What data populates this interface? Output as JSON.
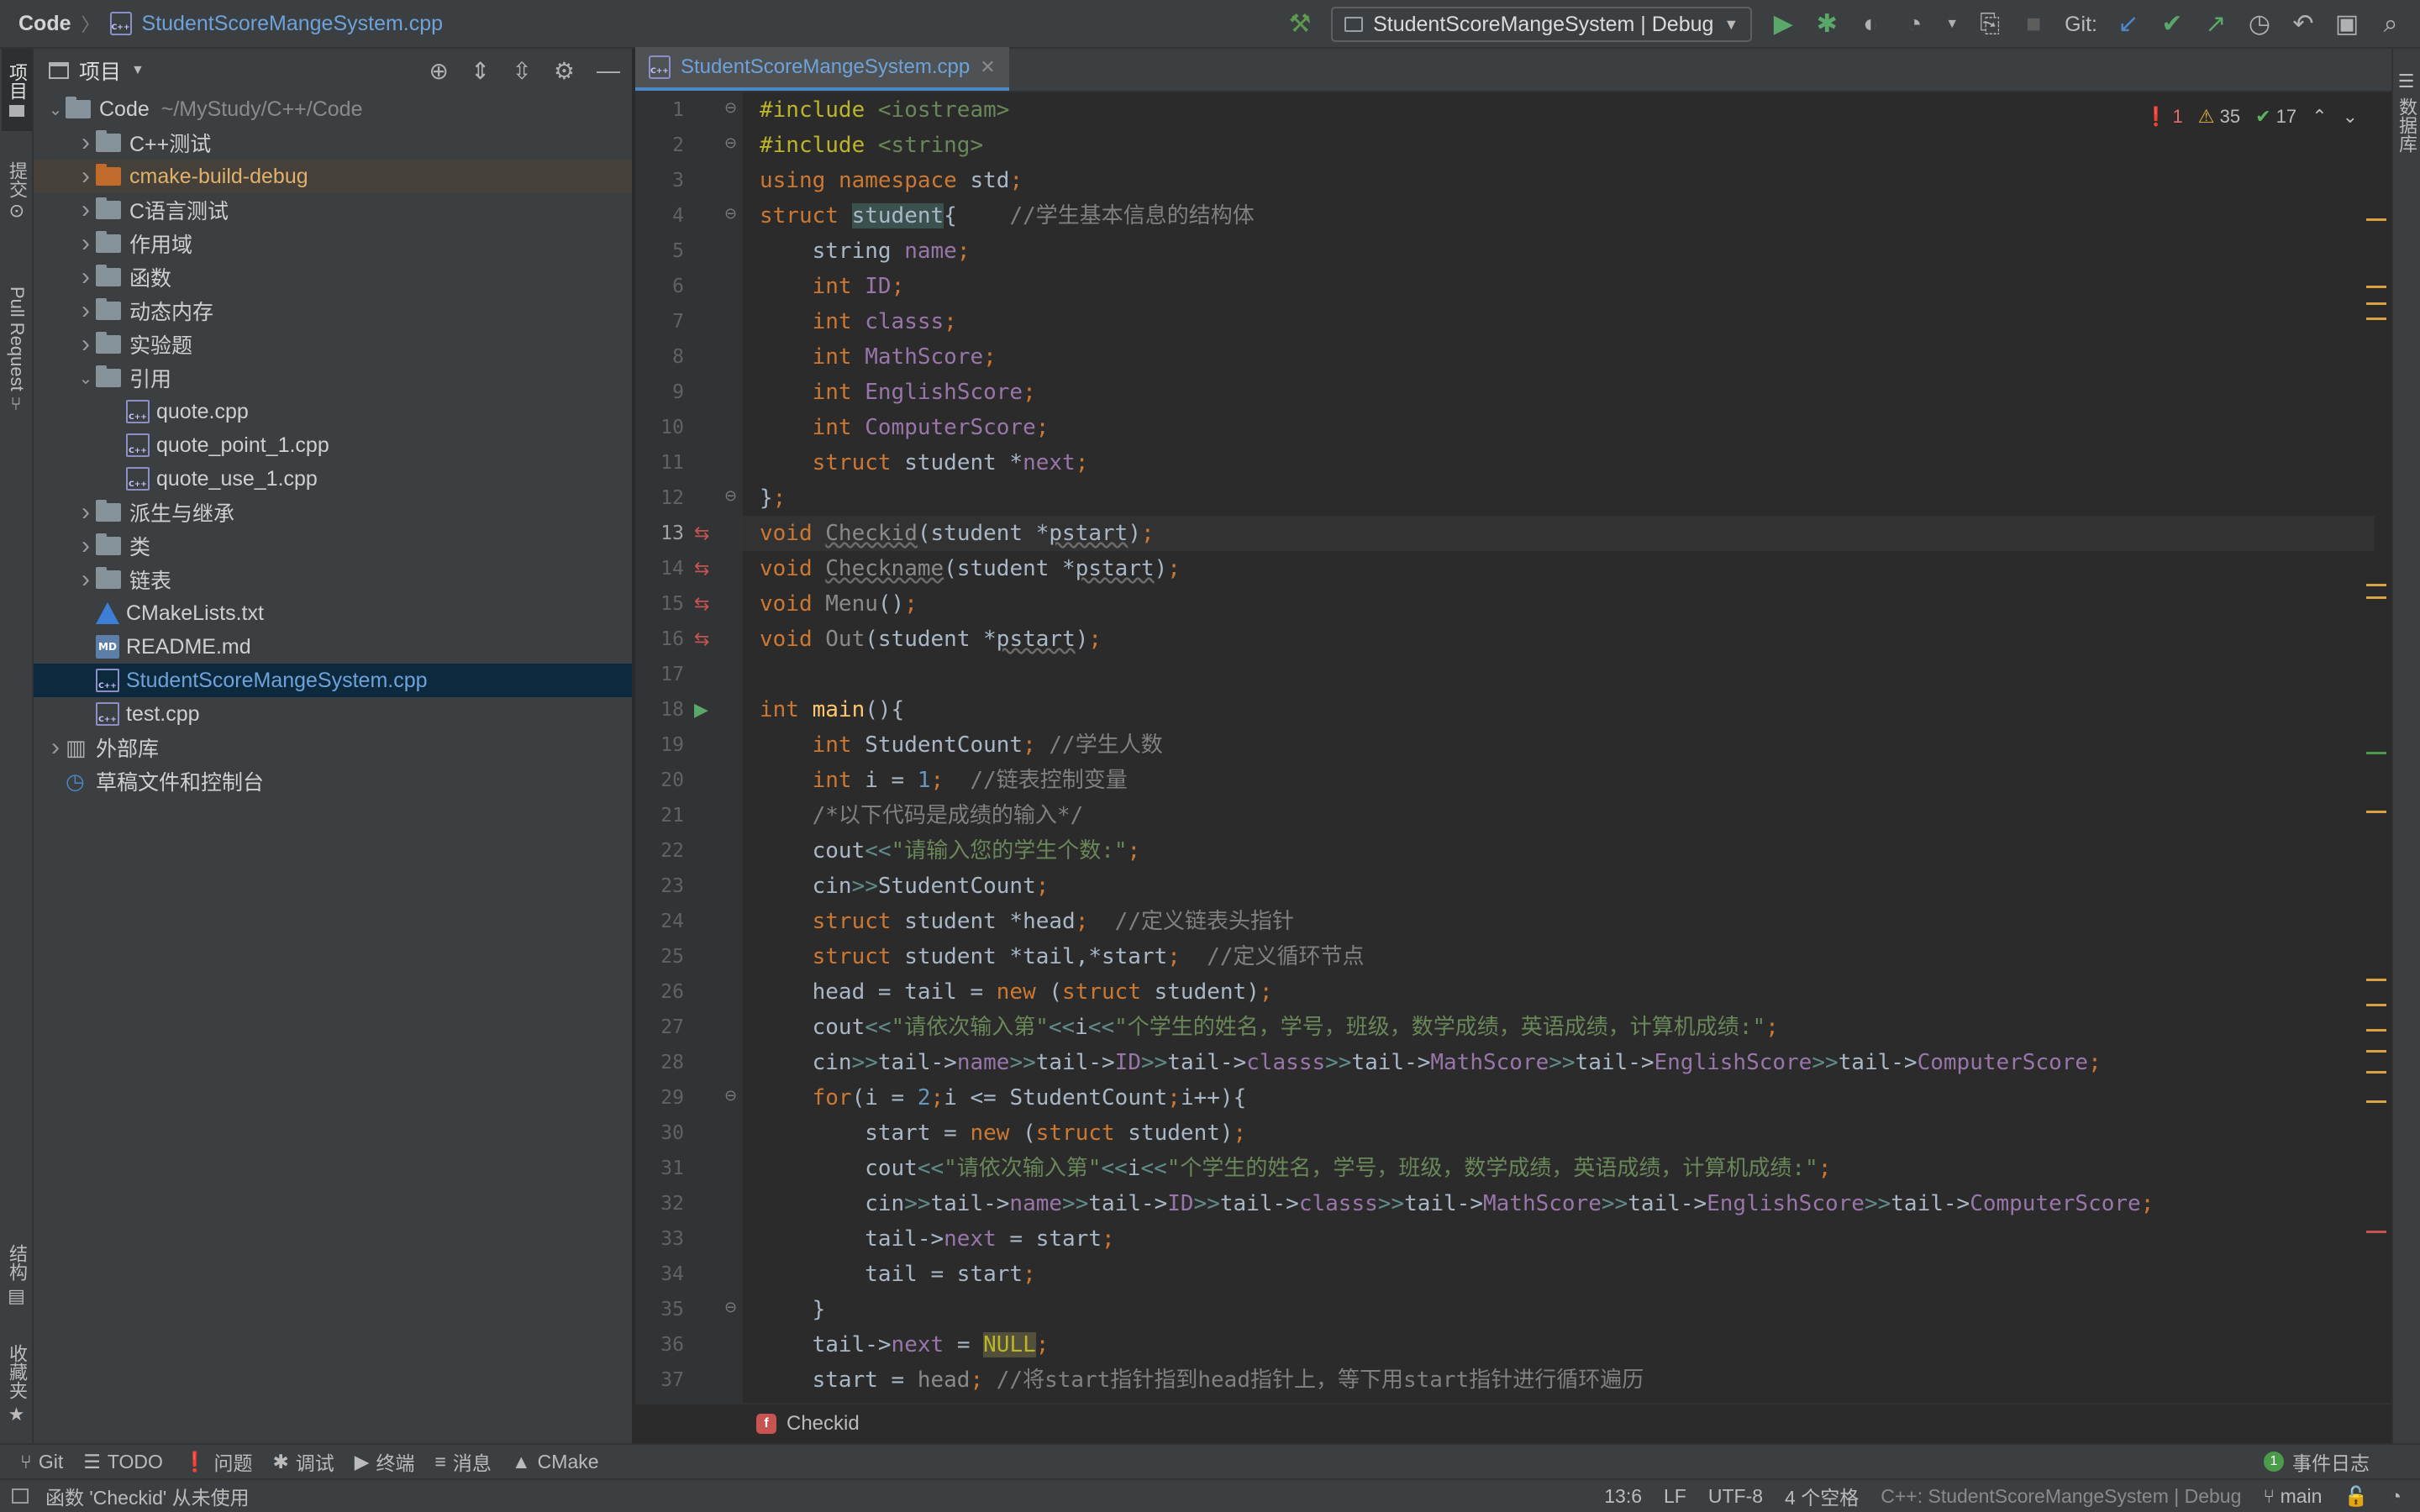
{
  "nav": {
    "root": "Code",
    "file": "StudentScoreMangeSystem.cpp",
    "run_config": "StudentScoreMangeSystem | Debug",
    "git_label": "Git:"
  },
  "left_strip": [
    "项目",
    "提交",
    "Pull Request",
    "结构",
    "收藏夹"
  ],
  "right_strip": [
    "数据库"
  ],
  "project": {
    "title": "项目",
    "tree": [
      {
        "label": "Code",
        "hint": "~/MyStudy/C++/Code",
        "depth": 0,
        "kind": "folder",
        "open": true
      },
      {
        "label": "C++测试",
        "depth": 1,
        "kind": "folder"
      },
      {
        "label": "cmake-build-debug",
        "depth": 1,
        "kind": "folder-excluded"
      },
      {
        "label": "C语言测试",
        "depth": 1,
        "kind": "folder"
      },
      {
        "label": "作用域",
        "depth": 1,
        "kind": "folder"
      },
      {
        "label": "函数",
        "depth": 1,
        "kind": "folder"
      },
      {
        "label": "动态内存",
        "depth": 1,
        "kind": "folder"
      },
      {
        "label": "实验题",
        "depth": 1,
        "kind": "folder"
      },
      {
        "label": "引用",
        "depth": 1,
        "kind": "folder",
        "open": true
      },
      {
        "label": "quote.cpp",
        "depth": 2,
        "kind": "cpp"
      },
      {
        "label": "quote_point_1.cpp",
        "depth": 2,
        "kind": "cpp"
      },
      {
        "label": "quote_use_1.cpp",
        "depth": 2,
        "kind": "cpp"
      },
      {
        "label": "派生与继承",
        "depth": 1,
        "kind": "folder"
      },
      {
        "label": "类",
        "depth": 1,
        "kind": "folder"
      },
      {
        "label": "链表",
        "depth": 1,
        "kind": "folder"
      },
      {
        "label": "CMakeLists.txt",
        "depth": 1,
        "kind": "cmake"
      },
      {
        "label": "README.md",
        "depth": 1,
        "kind": "md"
      },
      {
        "label": "StudentScoreMangeSystem.cpp",
        "depth": 1,
        "kind": "cpp",
        "selected": true
      },
      {
        "label": "test.cpp",
        "depth": 1,
        "kind": "cpp"
      },
      {
        "label": "外部库",
        "depth": 0,
        "kind": "lib"
      },
      {
        "label": "草稿文件和控制台",
        "depth": 0,
        "kind": "scratch"
      }
    ]
  },
  "editor": {
    "tab": "StudentScoreMangeSystem.cpp",
    "inspections": {
      "errors": "1",
      "warnings": "35",
      "ok": "17"
    },
    "breadcrumb": "Checkid",
    "lines": [
      "#include <iostream>",
      "#include <string>",
      "using namespace std;",
      "struct student{    //学生基本信息的结构体",
      "    string name;",
      "    int ID;",
      "    int classs;",
      "    int MathScore;",
      "    int EnglishScore;",
      "    int ComputerScore;",
      "    struct student *next;",
      "};",
      "void Checkid(student *pstart);",
      "void Checkname(student *pstart);",
      "void Menu();",
      "void Out(student *pstart);",
      "",
      "int main(){",
      "    int StudentCount; //学生人数",
      "    int i = 1;  //链表控制变量",
      "    /*以下代码是成绩的输入*/",
      "    cout<<\"请输入您的学生个数:\";",
      "    cin>>StudentCount;",
      "    struct student *head;  //定义链表头指针",
      "    struct student *tail,*start;  //定义循环节点",
      "    head = tail = new (struct student);",
      "    cout<<\"请依次输入第\"<<i<<\"个学生的姓名，学号，班级，数学成绩，英语成绩，计算机成绩:\";",
      "    cin>>tail->name>>tail->ID>>tail->classs>>tail->MathScore>>tail->EnglishScore>>tail->ComputerScore;",
      "    for(i = 2;i <= StudentCount;i++){",
      "        start = new (struct student);",
      "        cout<<\"请依次输入第\"<<i<<\"个学生的姓名，学号，班级，数学成绩，英语成绩，计算机成绩:\";",
      "        cin>>tail->name>>tail->ID>>tail->classs>>tail->MathScore>>tail->EnglishScore>>tail->ComputerScore;",
      "        tail->next = start;",
      "        tail = start;",
      "    }",
      "    tail->next = NULL;",
      "    start = head; //将start指针指到head指针上，等下用start指针进行循环遍历"
    ],
    "current_line": 13
  },
  "bottom_tools": [
    "Git",
    "TODO",
    "问题",
    "调试",
    "终端",
    "消息",
    "CMake"
  ],
  "event_log": {
    "count": "1",
    "label": "事件日志"
  },
  "status": {
    "message": "函数 'Checkid' 从未使用",
    "position": "13:6",
    "line_sep": "LF",
    "encoding": "UTF-8",
    "indent": "4 个空格",
    "context": "C++: StudentScoreMangeSystem | Debug",
    "branch": "main"
  }
}
